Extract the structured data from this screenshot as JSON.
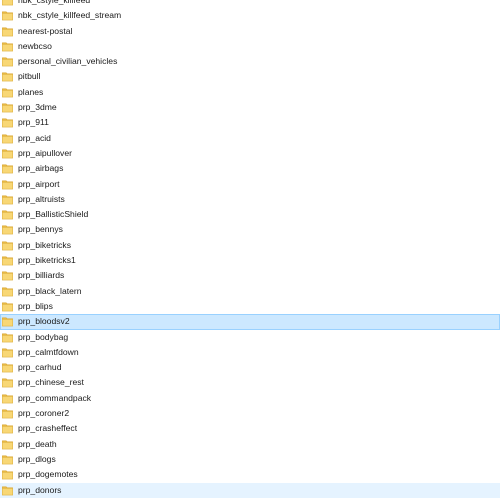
{
  "explorer": {
    "folder_icon": "folder-icon",
    "colors": {
      "selected_bg": "#cce8ff",
      "selected_border": "#99d1ff",
      "hover_bg": "#e5f3ff",
      "folder_yellow": "#f5d46b"
    },
    "items": [
      {
        "name": "nbk_cstyle_killfeed",
        "state": ""
      },
      {
        "name": "nbk_cstyle_killfeed_stream",
        "state": ""
      },
      {
        "name": "nearest-postal",
        "state": ""
      },
      {
        "name": "newbcso",
        "state": ""
      },
      {
        "name": "personal_civilian_vehicles",
        "state": ""
      },
      {
        "name": "pitbull",
        "state": ""
      },
      {
        "name": "planes",
        "state": ""
      },
      {
        "name": "prp_3dme",
        "state": ""
      },
      {
        "name": "prp_911",
        "state": ""
      },
      {
        "name": "prp_acid",
        "state": ""
      },
      {
        "name": "prp_aipullover",
        "state": ""
      },
      {
        "name": "prp_airbags",
        "state": ""
      },
      {
        "name": "prp_airport",
        "state": ""
      },
      {
        "name": "prp_altruists",
        "state": ""
      },
      {
        "name": "prp_BallisticShield",
        "state": ""
      },
      {
        "name": "prp_bennys",
        "state": ""
      },
      {
        "name": "prp_biketricks",
        "state": ""
      },
      {
        "name": "prp_biketricks1",
        "state": ""
      },
      {
        "name": "prp_billiards",
        "state": ""
      },
      {
        "name": "prp_black_latern",
        "state": ""
      },
      {
        "name": "prp_blips",
        "state": ""
      },
      {
        "name": "prp_bloodsv2",
        "state": "selected"
      },
      {
        "name": "prp_bodybag",
        "state": ""
      },
      {
        "name": "prp_calmtfdown",
        "state": ""
      },
      {
        "name": "prp_carhud",
        "state": ""
      },
      {
        "name": "prp_chinese_rest",
        "state": ""
      },
      {
        "name": "prp_commandpack",
        "state": ""
      },
      {
        "name": "prp_coroner2",
        "state": ""
      },
      {
        "name": "prp_crasheffect",
        "state": ""
      },
      {
        "name": "prp_death",
        "state": ""
      },
      {
        "name": "prp_dlogs",
        "state": ""
      },
      {
        "name": "prp_dogemotes",
        "state": ""
      },
      {
        "name": "prp_donors",
        "state": "hover"
      }
    ]
  }
}
